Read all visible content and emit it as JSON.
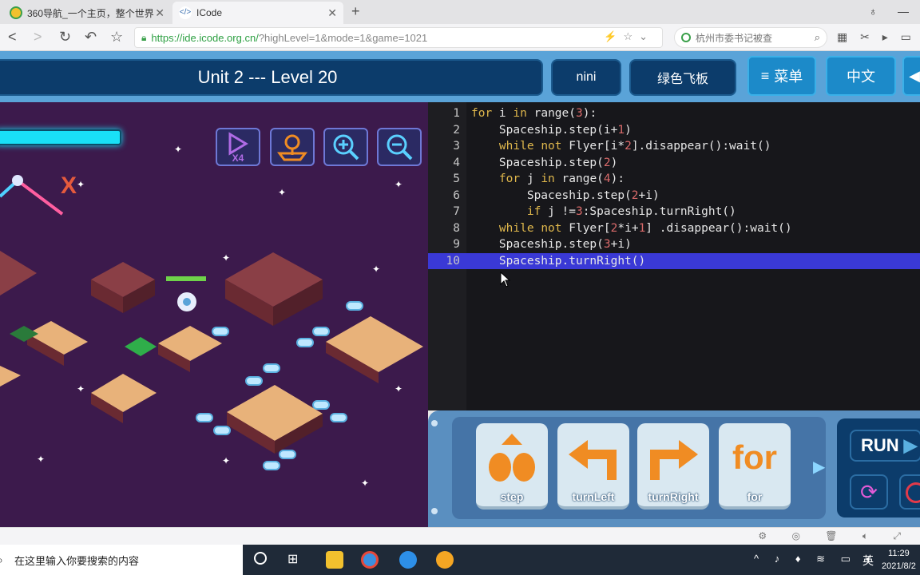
{
  "browser": {
    "tabs": [
      {
        "label": "360导航_一个主页，整个世界",
        "icon": "360-nav-icon"
      },
      {
        "label": "ICode",
        "icon": "code-icon"
      }
    ],
    "new_tab": "+",
    "url_main": "https://ide.icode.org.cn/",
    "url_rest": "?highLevel=1&mode=1&game=1021",
    "search_placeholder": "杭州市委书记被查"
  },
  "header": {
    "title": "Unit 2 --- Level 20",
    "user": "nini",
    "ship": "绿色飞板",
    "menu": "菜单",
    "lang": "中文",
    "menu_icon": "≡"
  },
  "game": {
    "speed_label": "X4",
    "buttons": [
      "play-x4-icon",
      "map-icon",
      "zoom-in-icon",
      "zoom-out-icon"
    ]
  },
  "editor": {
    "selected_line": 10,
    "lines": [
      [
        [
          "kw",
          "for"
        ],
        [
          "fn",
          " i "
        ],
        [
          "kw",
          "in"
        ],
        [
          "fn",
          " range("
        ],
        [
          "num",
          "3"
        ],
        [
          "fn",
          "):"
        ]
      ],
      [
        [
          "fn",
          "    Spaceship.step(i+"
        ],
        [
          "num",
          "1"
        ],
        [
          "fn",
          ")"
        ]
      ],
      [
        [
          "fn",
          "    "
        ],
        [
          "kw",
          "while"
        ],
        [
          "fn",
          " "
        ],
        [
          "kw",
          "not"
        ],
        [
          "fn",
          " Flyer[i*"
        ],
        [
          "num",
          "2"
        ],
        [
          "fn",
          "].disappear():wait()"
        ]
      ],
      [
        [
          "fn",
          "    Spaceship.step("
        ],
        [
          "num",
          "2"
        ],
        [
          "fn",
          ")"
        ]
      ],
      [
        [
          "fn",
          "    "
        ],
        [
          "kw",
          "for"
        ],
        [
          "fn",
          " j "
        ],
        [
          "kw",
          "in"
        ],
        [
          "fn",
          " range("
        ],
        [
          "num",
          "4"
        ],
        [
          "fn",
          "):"
        ]
      ],
      [
        [
          "fn",
          "        Spaceship.step("
        ],
        [
          "num",
          "2"
        ],
        [
          "fn",
          "+i)"
        ]
      ],
      [
        [
          "fn",
          "        "
        ],
        [
          "kw",
          "if"
        ],
        [
          "fn",
          " j !="
        ],
        [
          "num",
          "3"
        ],
        [
          "fn",
          ":Spaceship.turnRight()"
        ]
      ],
      [
        [
          "fn",
          "    "
        ],
        [
          "kw",
          "while"
        ],
        [
          "fn",
          " "
        ],
        [
          "kw",
          "not"
        ],
        [
          "fn",
          " Flyer["
        ],
        [
          "num",
          "2"
        ],
        [
          "fn",
          "*i+"
        ],
        [
          "num",
          "1"
        ],
        [
          "fn",
          "] .disappear():wait()"
        ]
      ],
      [
        [
          "fn",
          "    Spaceship.step("
        ],
        [
          "num",
          "3"
        ],
        [
          "fn",
          "+i)"
        ]
      ],
      [
        [
          "fn",
          "    Spaceship.turnRight()"
        ]
      ]
    ]
  },
  "blocks": [
    {
      "label": "step",
      "icon": "step-icon"
    },
    {
      "label": "turnLeft",
      "icon": "turn-left-icon"
    },
    {
      "label": "turnRight",
      "icon": "turn-right-icon"
    },
    {
      "label": "for",
      "icon": "for-icon"
    }
  ],
  "run": {
    "label": "RUN"
  },
  "taskbar": {
    "search_placeholder": "在这里输入你要搜索的内容",
    "ime": "英",
    "time": "11:29",
    "date": "2021/8/2"
  }
}
